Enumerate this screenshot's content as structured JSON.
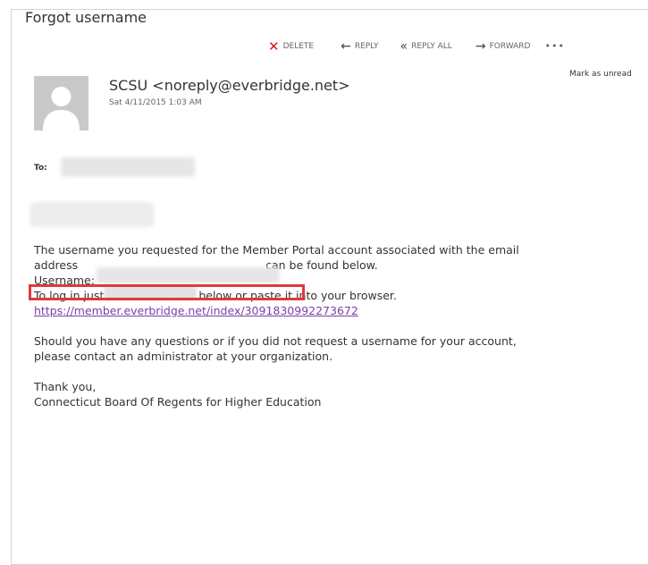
{
  "email": {
    "subject": "Forgot username",
    "toolbar": {
      "delete": "DELETE",
      "reply": "REPLY",
      "reply_all": "REPLY ALL",
      "forward": "FORWARD",
      "more": "•••"
    },
    "sender": "SCSU <noreply@everbridge.net>",
    "date": "Sat 4/11/2015 1:03 AM",
    "mark_unread": "Mark as unread",
    "to_label": "To:",
    "body": {
      "line1": "The username you requested for the Member Portal account associated with the email",
      "line2_prefix": "address",
      "line2_suffix": "can be found below.",
      "username_label": "Username:",
      "login_instruction": "To log in just click on the link below or paste it into your browser.",
      "link": "https://member.everbridge.net/index/3091830992273672",
      "questions_line1": "Should you have any questions or if you did not request a username for your account,",
      "questions_line2": "please contact an administrator at your organization.",
      "thanks": "Thank you,",
      "org": "Connecticut Board Of Regents for Higher Education"
    }
  },
  "colors": {
    "delete_icon": "#d41c1c",
    "highlight_box": "#e0393e",
    "link": "#7a3fa8",
    "avatar_bg": "#c9c9c9"
  }
}
